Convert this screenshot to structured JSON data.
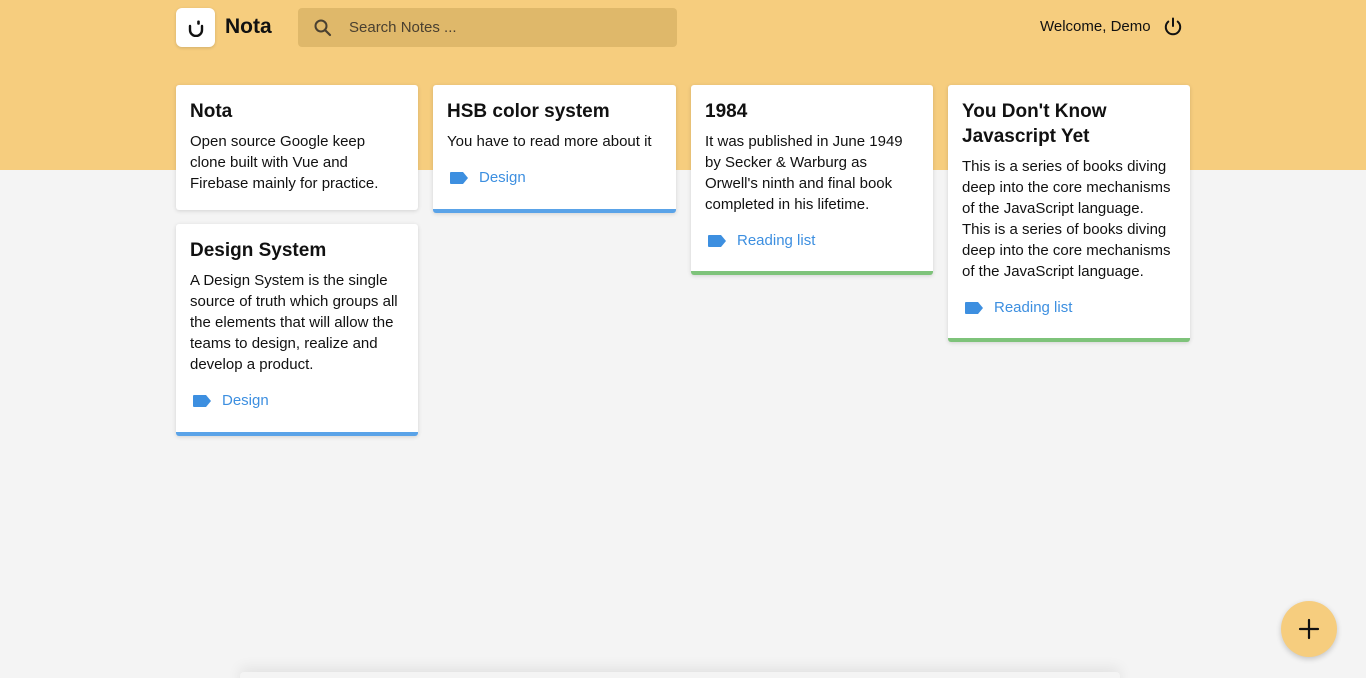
{
  "app": {
    "name": "Nota",
    "logo_icon": "nota-logo-icon"
  },
  "search": {
    "placeholder": "Search Notes ...",
    "icon": "search-icon"
  },
  "user": {
    "welcome": "Welcome, Demo",
    "logout_icon": "power-icon"
  },
  "colors": {
    "banner": "#f6cd7e",
    "tag": "#3d8fe0",
    "design_border": "#5aa3e8",
    "reading_border": "#7ec37a"
  },
  "notes": [
    {
      "title": "Nota",
      "body": "Open source Google keep clone built with Vue and Firebase mainly for practice.",
      "tag": ""
    },
    {
      "title": "HSB color system",
      "body": "You have to read more about it",
      "tag": "Design"
    },
    {
      "title": "1984",
      "body": "It was published in June 1949 by Secker & Warburg as Orwell's ninth and final book completed in his lifetime.",
      "tag": "Reading list"
    },
    {
      "title": "You Don't Know Javascript Yet",
      "body": "This is a series of books diving deep into the core mechanisms of the JavaScript language. This is a series of books diving deep into the core mechanisms of the JavaScript language.",
      "tag": "Reading list"
    },
    {
      "title": "Design System",
      "body": "A Design System is the single source of truth which groups all the elements that will allow the teams to design, realize and develop a product.",
      "tag": "Design"
    }
  ],
  "fab": {
    "icon": "plus-icon"
  }
}
